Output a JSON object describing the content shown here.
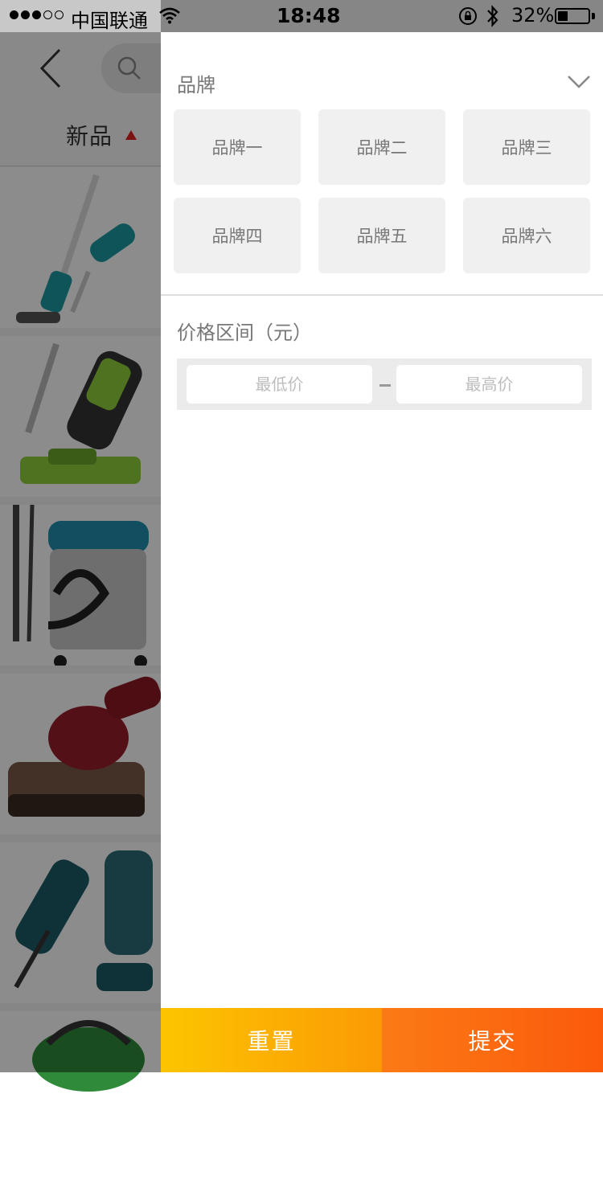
{
  "status_bar": {
    "carrier": "中国联通",
    "time": "18:48",
    "battery_percent": "32%",
    "battery_level": 0.32,
    "signal_bars_filled": 3,
    "signal_bars_total": 5
  },
  "background_page": {
    "sort_label": "新品"
  },
  "filter": {
    "brand_section_title": "品牌",
    "brands": [
      {
        "label": "品牌一"
      },
      {
        "label": "品牌二"
      },
      {
        "label": "品牌三"
      },
      {
        "label": "品牌四"
      },
      {
        "label": "品牌五"
      },
      {
        "label": "品牌六"
      }
    ],
    "price_section_title": "价格区间（元）",
    "price_min_placeholder": "最低价",
    "price_max_placeholder": "最高价",
    "reset_label": "重置",
    "submit_label": "提交"
  },
  "colors": {
    "reset_gradient": [
      "#fcc500",
      "#fb9a05"
    ],
    "submit_gradient": [
      "#fb7a16",
      "#fb5a0a"
    ],
    "sort_indicator": "#e02020"
  }
}
